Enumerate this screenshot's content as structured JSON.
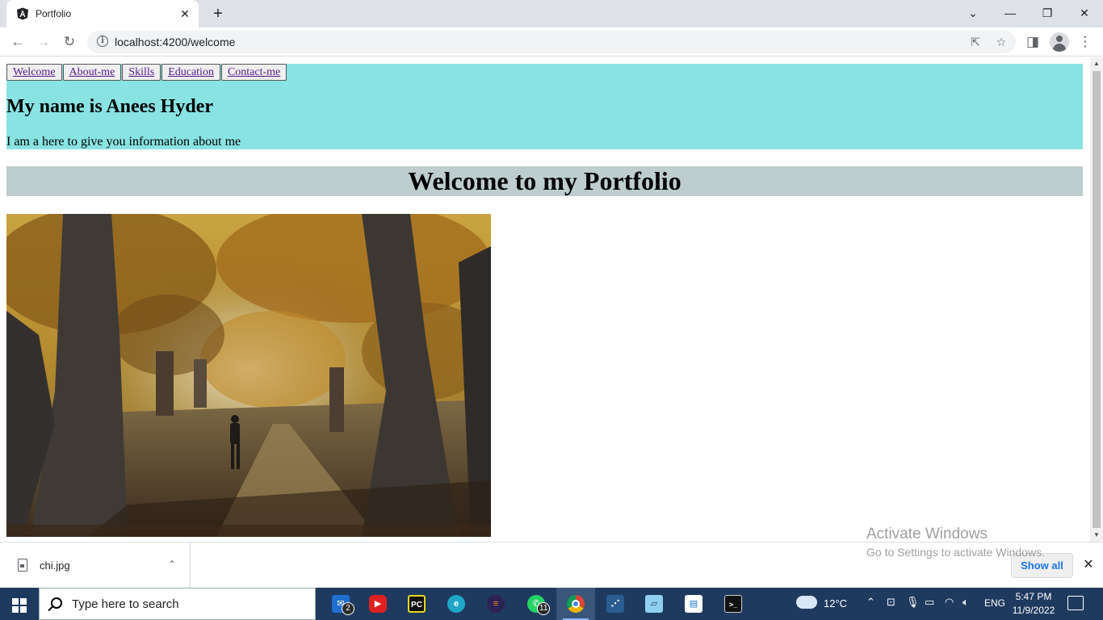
{
  "browser": {
    "tab_title": "Portfolio",
    "tab_close": "✕",
    "new_tab": "+",
    "url": "localhost:4200/welcome",
    "window_controls": {
      "dropdown": "⌄",
      "minimize": "—",
      "restore": "❐",
      "close": "✕"
    },
    "toolbar_icons": {
      "back": "←",
      "forward": "→",
      "reload": "↻",
      "info": "i",
      "share": "⇱",
      "star": "☆",
      "sidepanel": "◨",
      "menu": "⋮"
    }
  },
  "page": {
    "nav": [
      "Welcome",
      "About-me",
      "Skills",
      "Education",
      "Contact-me"
    ],
    "name_heading": "My name is Anees Hyder",
    "intro": "I am a here to give you information about me",
    "welcome_heading": "Welcome to my Portfolio"
  },
  "downloads": {
    "filename": "chi.jpg",
    "chevron": "⌃",
    "show_all": "Show all",
    "close": "✕"
  },
  "watermark": {
    "line1": "Activate Windows",
    "line2": "Go to Settings to activate Windows."
  },
  "taskbar": {
    "search_placeholder": "Type here to search",
    "mail_badge": "2",
    "whatsapp_badge": "11",
    "temperature": "12°C",
    "language": "ENG",
    "time": "5:47 PM",
    "date": "11/9/2022"
  },
  "colors": {
    "header_band": "#89e3e3",
    "welcome_band": "#becdcd",
    "link": "#551a8b",
    "taskbar": "#1f3a5f"
  }
}
